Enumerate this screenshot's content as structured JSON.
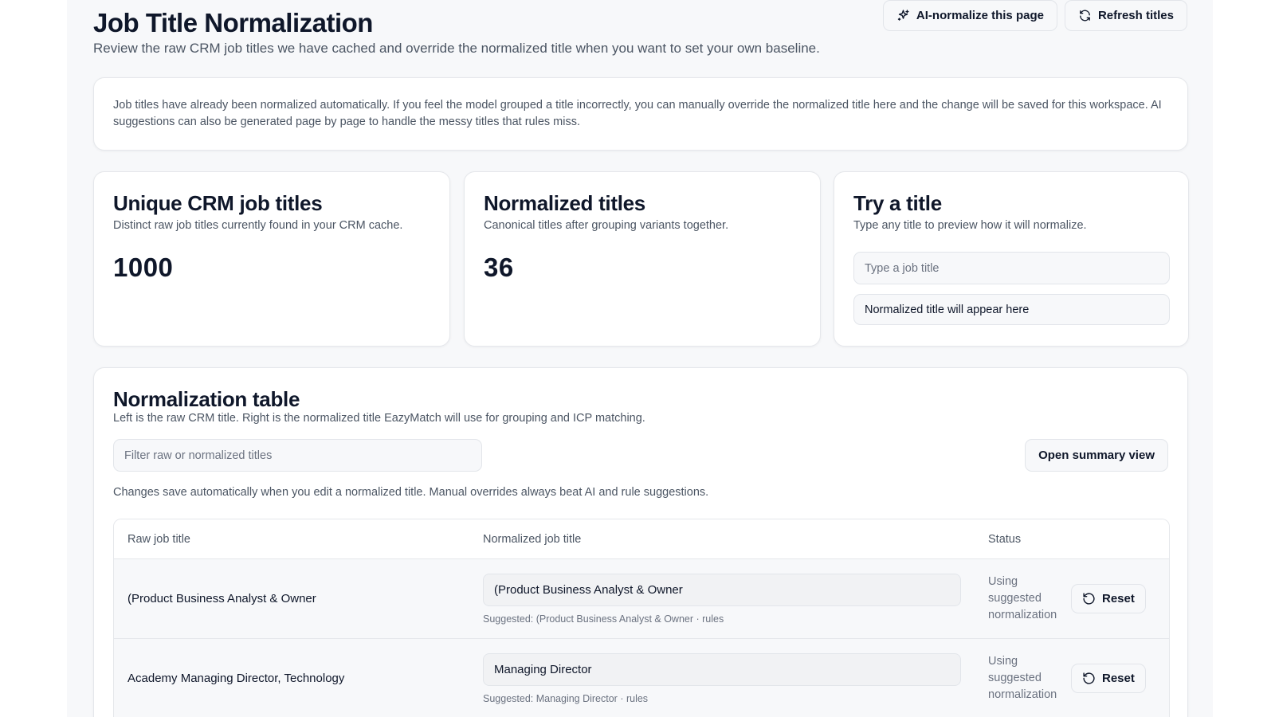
{
  "header": {
    "title": "Job Title Normalization",
    "subtitle": "Review the raw CRM job titles we have cached and override the normalized title when you want to set your own baseline.",
    "ai_button_label": "AI-normalize this page",
    "refresh_button_label": "Refresh titles"
  },
  "info": {
    "text": "Job titles have already been normalized automatically. If you feel the model grouped a title incorrectly, you can manually override the normalized title here and the change will be saved for this workspace. AI suggestions can also be generated page by page to handle the messy titles that rules miss."
  },
  "stats": {
    "unique": {
      "title": "Unique CRM job titles",
      "description": "Distinct raw job titles currently found in your CRM cache.",
      "value": "1000"
    },
    "normalized": {
      "title": "Normalized titles",
      "description": "Canonical titles after grouping variants together.",
      "value": "36"
    }
  },
  "try_title": {
    "title": "Try a title",
    "description": "Type any title to preview how it will normalize.",
    "input_placeholder": "Type a job title",
    "result_placeholder": "Normalized title will appear here"
  },
  "table_section": {
    "title": "Normalization table",
    "description": "Left is the raw CRM title. Right is the normalized title EazyMatch will use for grouping and ICP matching.",
    "filter_placeholder": "Filter raw or normalized titles",
    "summary_button_label": "Open summary view",
    "autosave_note": "Changes save automatically when you edit a normalized title. Manual overrides always beat AI and rule suggestions.",
    "columns": {
      "raw": "Raw job title",
      "normalized": "Normalized job title",
      "status": "Status"
    },
    "rows": [
      {
        "raw": "(Product Business Analyst & Owner",
        "normalized": "(Product Business Analyst & Owner",
        "suggested": "Suggested: (Product Business Analyst & Owner · rules",
        "status": "Using suggested normalization",
        "reset_label": "Reset"
      },
      {
        "raw": "Academy Managing Director, Technology",
        "normalized": "Managing Director",
        "suggested": "Suggested: Managing Director · rules",
        "status": "Using suggested normalization",
        "reset_label": "Reset"
      }
    ]
  },
  "icons": {
    "ai": "sparkles-icon",
    "refresh": "refresh-icon",
    "reset": "rotate-ccw-icon"
  }
}
